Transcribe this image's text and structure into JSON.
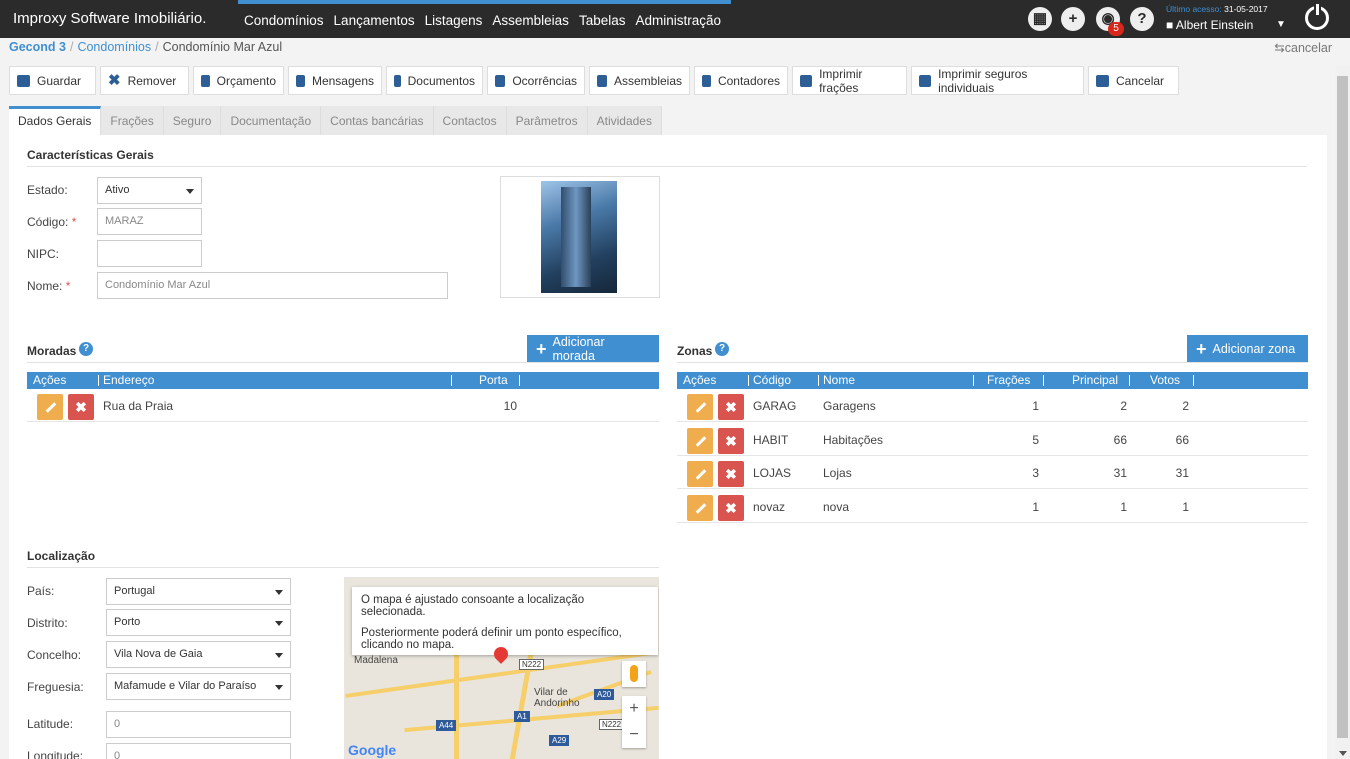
{
  "app": {
    "brand": "Improxy Software Imobiliário.",
    "nav": [
      "Condomínios",
      "Lançamentos",
      "Listagens",
      "Assembleias",
      "Tabelas",
      "Administração"
    ],
    "notifications_count": "5",
    "last_access_label": "Último acesso:",
    "last_access_date": "31-05-2017",
    "user_name": "Albert Einstein"
  },
  "breadcrumb": {
    "root": "Gecond 3",
    "section": "Condomínios",
    "current": "Condomínio Mar Azul"
  },
  "cancel_link": "cancelar",
  "toolbar": [
    "Guardar",
    "Remover",
    "Orçamento",
    "Mensagens",
    "Documentos",
    "Ocorrências",
    "Assembleias",
    "Contadores",
    "Imprimir frações",
    "Imprimir seguros individuais",
    "Cancelar"
  ],
  "tabs": [
    "Dados Gerais",
    "Frações",
    "Seguro",
    "Documentação",
    "Contas bancárias",
    "Contactos",
    "Parâmetros",
    "Atividades"
  ],
  "general": {
    "title": "Características Gerais",
    "estado_label": "Estado:",
    "estado_value": "Ativo",
    "codigo_label": "Código:",
    "codigo_value": "MARAZ",
    "nipc_label": "NIPC:",
    "nipc_value": "",
    "nome_label": "Nome:",
    "nome_value": "Condomínio Mar Azul",
    "required_mark": "*"
  },
  "moradas": {
    "title": "Moradas",
    "add_label": "Adicionar morada",
    "columns": [
      "Ações",
      "Endereço",
      "Porta"
    ],
    "rows": [
      {
        "endereco": "Rua da Praia",
        "porta": "10"
      }
    ]
  },
  "zonas": {
    "title": "Zonas",
    "add_label": "Adicionar zona",
    "columns": [
      "Ações",
      "Código",
      "Nome",
      "Frações",
      "Principal",
      "Votos"
    ],
    "rows": [
      {
        "codigo": "GARAG",
        "nome": "Garagens",
        "fracoes": "1",
        "principal": "2",
        "votos": "2"
      },
      {
        "codigo": "HABIT",
        "nome": "Habitações",
        "fracoes": "5",
        "principal": "66",
        "votos": "66"
      },
      {
        "codigo": "LOJAS",
        "nome": "Lojas",
        "fracoes": "3",
        "principal": "31",
        "votos": "31"
      },
      {
        "codigo": "novaz",
        "nome": "nova",
        "fracoes": "1",
        "principal": "1",
        "votos": "1"
      }
    ]
  },
  "localizacao": {
    "title": "Localização",
    "pais_label": "País:",
    "pais_value": "Portugal",
    "distrito_label": "Distrito:",
    "distrito_value": "Porto",
    "concelho_label": "Concelho:",
    "concelho_value": "Vila Nova de Gaia",
    "freguesia_label": "Freguesia:",
    "freguesia_value": "Mafamude e Vilar do Paraíso",
    "latitude_label": "Latitude:",
    "latitude_value": "0",
    "longitude_label": "Longitude:",
    "longitude_value": "0"
  },
  "map": {
    "note_line1": "O mapa é ajustado consoante a localização selecionada.",
    "note_line2": "Posteriormente poderá definir um ponto específico, clicando no mapa.",
    "place1": "Madalena",
    "place2": "Vilar de Andorinho",
    "roads": [
      "N222",
      "A20",
      "A44",
      "A1",
      "N222",
      "A29"
    ],
    "zoom_in": "+",
    "zoom_out": "−",
    "logo": "Google"
  }
}
